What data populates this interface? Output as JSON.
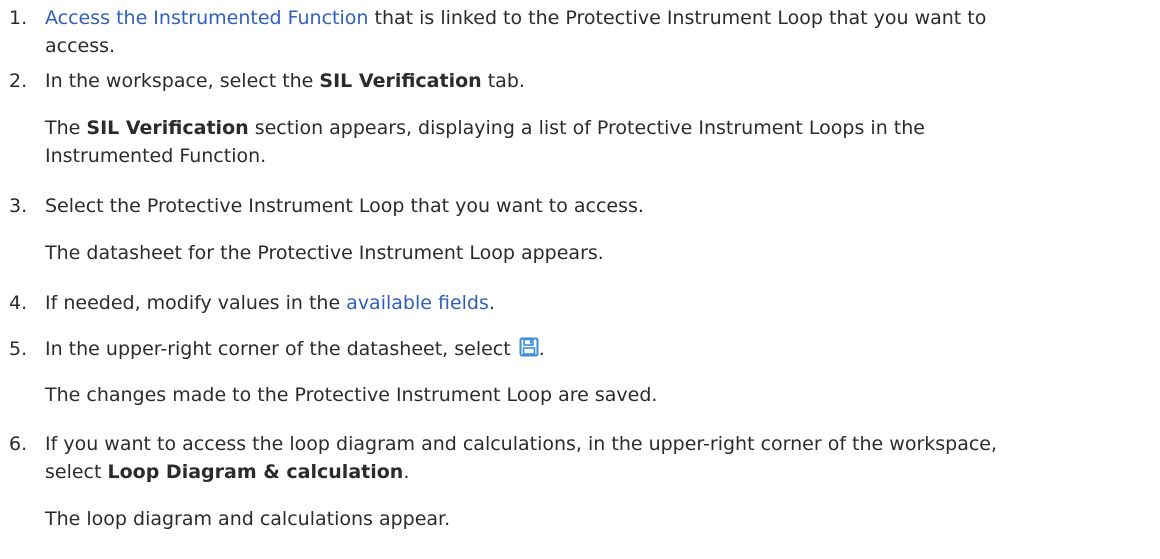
{
  "steps": [
    {
      "num": "1.",
      "link": "Access the Instrumented Function",
      "text_a": " that is linked to the Protective Instrument Loop that you want to",
      "text_b": "access."
    },
    {
      "num": "2.",
      "pre": "In the workspace, select the ",
      "bold": "SIL Verification",
      "post": " tab.",
      "note_bold": "SIL Verification",
      "note_a": " section appears, displaying a list of Protective Instrument Loops in the",
      "note_b": "Instrumented Function."
    },
    {
      "num": "3.",
      "text": "Select the Protective Instrument Loop that you want to access.",
      "note": "The datasheet for the Protective Instrument Loop appears."
    },
    {
      "num": "4.",
      "pre": "If needed, modify values in the ",
      "link": "available fields",
      "post": "."
    },
    {
      "num": "5.",
      "pre": "In the upper-right corner of the datasheet, select ",
      "icon": "save-icon",
      "post": ".",
      "note": "The changes made to the Protective Instrument Loop are saved."
    },
    {
      "num": "6.",
      "text_a": "If you want to access the loop diagram and calculations, in the upper-right corner of the workspace,",
      "pre_b": "select ",
      "bold": "Loop Diagram & calculation",
      "post_b": ".",
      "note": "The loop diagram and calculations appear."
    }
  ],
  "colors": {
    "link": "#2f5fbd",
    "icon": "#3a8fd6"
  }
}
